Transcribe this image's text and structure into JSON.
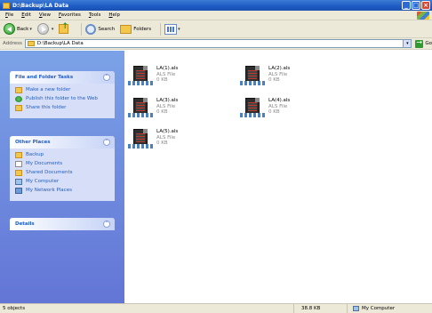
{
  "window": {
    "title": "D:\\Backup\\LA Data"
  },
  "menu": [
    "File",
    "Edit",
    "View",
    "Favorites",
    "Tools",
    "Help"
  ],
  "toolbar": {
    "back_label": "Back",
    "search_label": "Search",
    "folders_label": "Folders"
  },
  "address": {
    "label": "Address",
    "value": "D:\\Backup\\LA Data",
    "go_label": "Go"
  },
  "tasks": {
    "file_folder": {
      "title": "File and Folder Tasks",
      "items": [
        "Make a new folder",
        "Publish this folder to the Web",
        "Share this folder"
      ]
    },
    "other_places": {
      "title": "Other Places",
      "items": [
        "Backup",
        "My Documents",
        "Shared Documents",
        "My Computer",
        "My Network Places"
      ]
    },
    "details": {
      "title": "Details"
    }
  },
  "files": [
    {
      "name": "LA(1).als",
      "type": "ALS File",
      "size": "0 KB"
    },
    {
      "name": "LA(2).als",
      "type": "ALS File",
      "size": "0 KB"
    },
    {
      "name": "LA(3).als",
      "type": "ALS File",
      "size": "0 KB"
    },
    {
      "name": "LA(4).als",
      "type": "ALS File",
      "size": "0 KB"
    },
    {
      "name": "LA(5).als",
      "type": "ALS File",
      "size": "0 KB"
    }
  ],
  "status": {
    "objects": "5 objects",
    "size": "38.8 KB",
    "zone": "My Computer"
  }
}
